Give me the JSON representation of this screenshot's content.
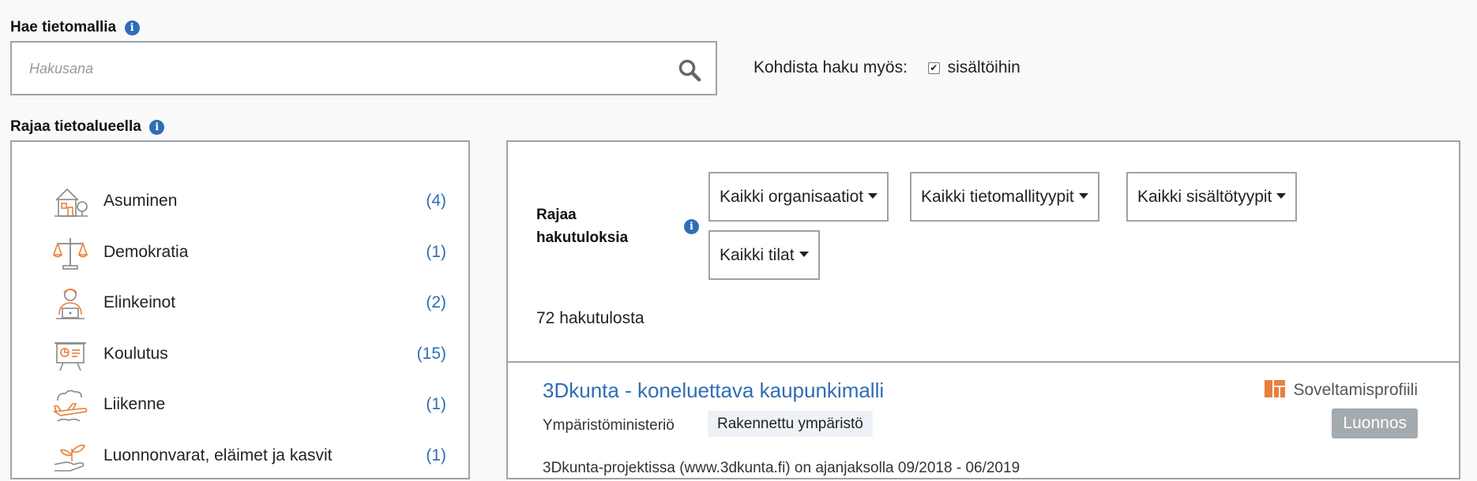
{
  "search": {
    "label": "Hae tietomallia",
    "placeholder": "Hakusana",
    "target_label": "Kohdista haku myös:",
    "contents_checkbox_label": "sisältöihin",
    "contents_checked": true
  },
  "domains": {
    "label": "Rajaa tietoalueella",
    "items": [
      {
        "label": "Asuminen",
        "count": "(4)",
        "icon": "house-icon"
      },
      {
        "label": "Demokratia",
        "count": "(1)",
        "icon": "scales-icon"
      },
      {
        "label": "Elinkeinot",
        "count": "(2)",
        "icon": "worker-laptop-icon"
      },
      {
        "label": "Koulutus",
        "count": "(15)",
        "icon": "presentation-board-icon"
      },
      {
        "label": "Liikenne",
        "count": "(1)",
        "icon": "airplane-icon"
      },
      {
        "label": "Luonnonvarat, eläimet ja kasvit",
        "count": "(1)",
        "icon": "plant-hand-icon"
      }
    ]
  },
  "filters": {
    "label": "Rajaa hakutuloksia",
    "organizations": "Kaikki organisaatiot",
    "model_types": "Kaikki tietomallityypit",
    "content_types": "Kaikki sisältötyypit",
    "states": "Kaikki tilat"
  },
  "results": {
    "count_text": "72 hakutulosta",
    "items": [
      {
        "title": "3Dkunta - koneluettava kaupunkimalli",
        "organization": "Ympäristöministeriö",
        "domain_tag": "Rakennettu ympäristö",
        "type_label": "Soveltamisprofiili",
        "status": "Luonnos",
        "description": "3Dkunta-projektissa (www.3dkunta.fi) on ajanjaksolla 09/2018 - 06/2019"
      }
    ]
  },
  "colors": {
    "accent": "#2f6db5",
    "icon_orange": "#e8803a",
    "status_badge": "#a3aab0",
    "tag_bg": "#eef2f7"
  }
}
